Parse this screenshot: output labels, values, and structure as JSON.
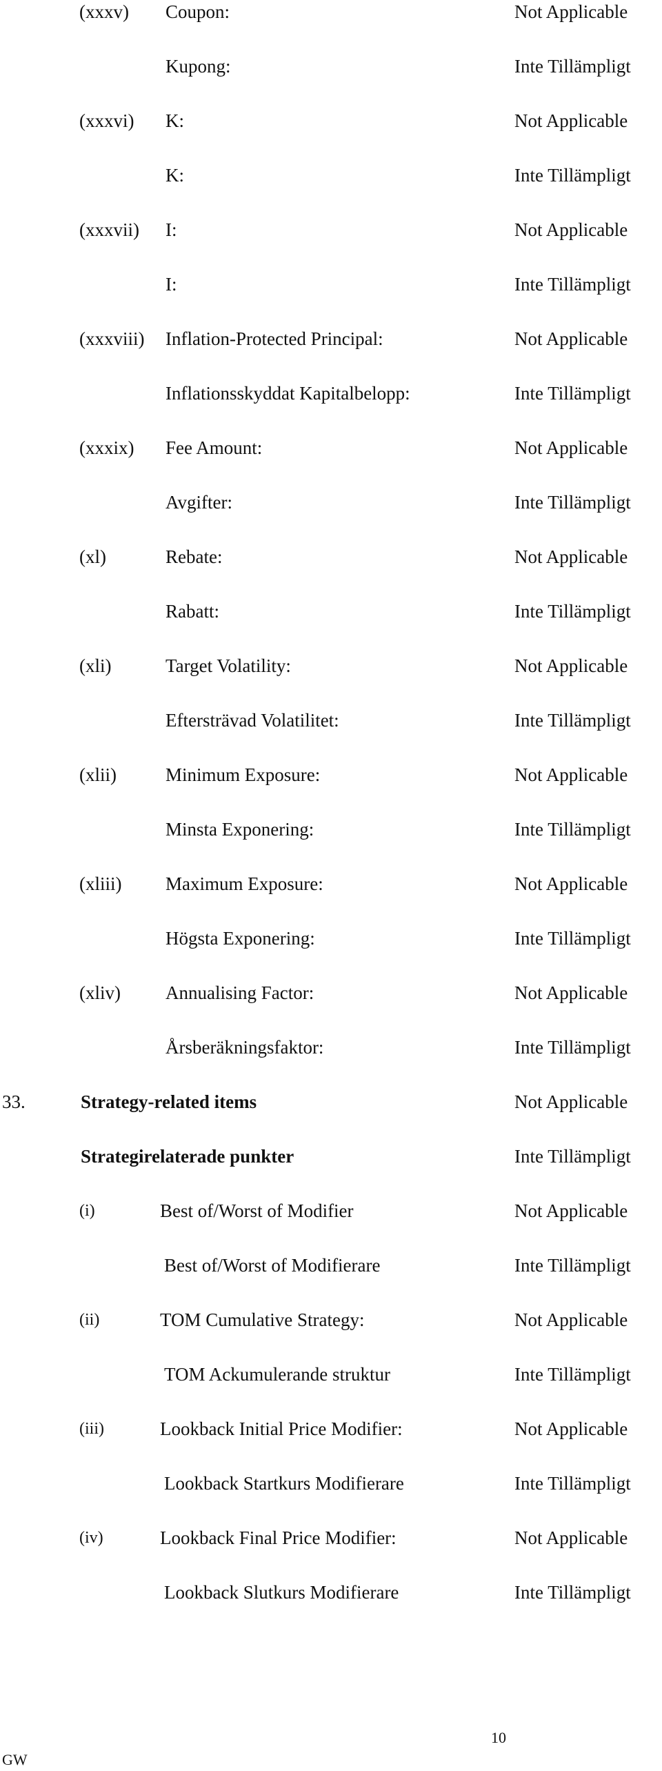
{
  "items": [
    {
      "num": "(xxxv)",
      "en": "Coupon:",
      "sv": "Kupong:",
      "value_en": "Not Applicable",
      "value_sv": "Inte Tillämpligt"
    },
    {
      "num": "(xxxvi)",
      "en": "K:",
      "sv": "K:",
      "value_en": "Not Applicable",
      "value_sv": "Inte Tillämpligt"
    },
    {
      "num": "(xxxvii)",
      "en": "I:",
      "sv": "I:",
      "value_en": "Not Applicable",
      "value_sv": "Inte Tillämpligt"
    },
    {
      "num": "(xxxviii)",
      "en": "Inflation-Protected Principal:",
      "sv": "Inflationsskyddat Kapitalbelopp:",
      "value_en": "Not Applicable",
      "value_sv": "Inte Tillämpligt"
    },
    {
      "num": "(xxxix)",
      "en": "Fee Amount:",
      "sv": "Avgifter:",
      "value_en": "Not Applicable",
      "value_sv": "Inte Tillämpligt"
    },
    {
      "num": "(xl)",
      "en": "Rebate:",
      "sv": "Rabatt:",
      "value_en": "Not Applicable",
      "value_sv": "Inte Tillämpligt"
    },
    {
      "num": "(xli)",
      "en": "Target Volatility:",
      "sv": "Eftersträvad Volatilitet:",
      "value_en": "Not Applicable",
      "value_sv": "Inte Tillämpligt"
    },
    {
      "num": "(xlii)",
      "en": "Minimum Exposure:",
      "sv": "Minsta Exponering:",
      "value_en": "Not Applicable",
      "value_sv": "Inte Tillämpligt"
    },
    {
      "num": "(xliii)",
      "en": "Maximum Exposure:",
      "sv": "Högsta Exponering:",
      "value_en": "Not Applicable",
      "value_sv": "Inte Tillämpligt"
    },
    {
      "num": "(xliv)",
      "en": "Annualising Factor:",
      "sv": "Årsberäkningsfaktor:",
      "value_en": "Not Applicable",
      "value_sv": "Inte Tillämpligt"
    }
  ],
  "section": {
    "num": "33.",
    "en": "Strategy-related items",
    "sv": "Strategirelaterade punkter",
    "value_en": "Not Applicable",
    "value_sv": "Inte Tillämpligt",
    "subitems": [
      {
        "num": "(i)",
        "en": "Best of/Worst of Modifier",
        "sv": "Best of/Worst of Modifierare",
        "value_en": "Not Applicable",
        "value_sv": "Inte Tillämpligt"
      },
      {
        "num": "(ii)",
        "en": "TOM Cumulative Strategy:",
        "sv": "TOM Ackumulerande struktur",
        "value_en": "Not Applicable",
        "value_sv": "Inte Tillämpligt"
      },
      {
        "num": "(iii)",
        "en": "Lookback Initial Price Modifier:",
        "sv": "Lookback Startkurs Modifierare",
        "value_en": "Not Applicable",
        "value_sv": "Inte Tillämpligt"
      },
      {
        "num": "(iv)",
        "en": "Lookback Final Price Modifier:",
        "sv": "Lookback Slutkurs Modifierare",
        "value_en": "Not Applicable",
        "value_sv": "Inte Tillämpligt"
      }
    ]
  },
  "footer": {
    "page_number": "10",
    "initials": "GW"
  }
}
